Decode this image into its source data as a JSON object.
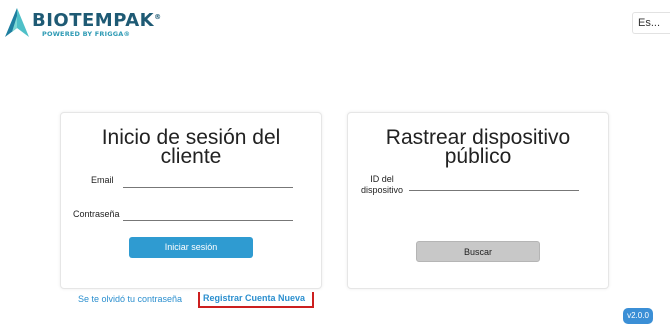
{
  "brand": {
    "name": "BIOTEMPAK",
    "registered": "®",
    "tagline": "POWERED BY FRIGGA",
    "tagline_mark": "®",
    "colors": {
      "primary": "#1e5a74",
      "accent": "#2f9bb5"
    }
  },
  "header": {
    "language": "Es..."
  },
  "login_card": {
    "title": "Inicio de sesión del cliente",
    "email_label": "Email",
    "email_value": "",
    "password_label": "Contraseña",
    "password_value": "",
    "submit_label": "Iniciar sesión",
    "submit_color": "#2f9bd1"
  },
  "track_card": {
    "title": "Rastrear dispositivo público",
    "device_id_label_line1": "ID del",
    "device_id_label_line2": "dispositivo",
    "device_id_value": "",
    "search_label": "Buscar"
  },
  "links": {
    "forgot": "Se te olvidó tu contraseña",
    "register": "Registrar Cuenta Nueva",
    "register_highlight_color": "#cc1f1f",
    "link_color": "#2b8fcf"
  },
  "footer": {
    "version": "v2.0.0"
  }
}
